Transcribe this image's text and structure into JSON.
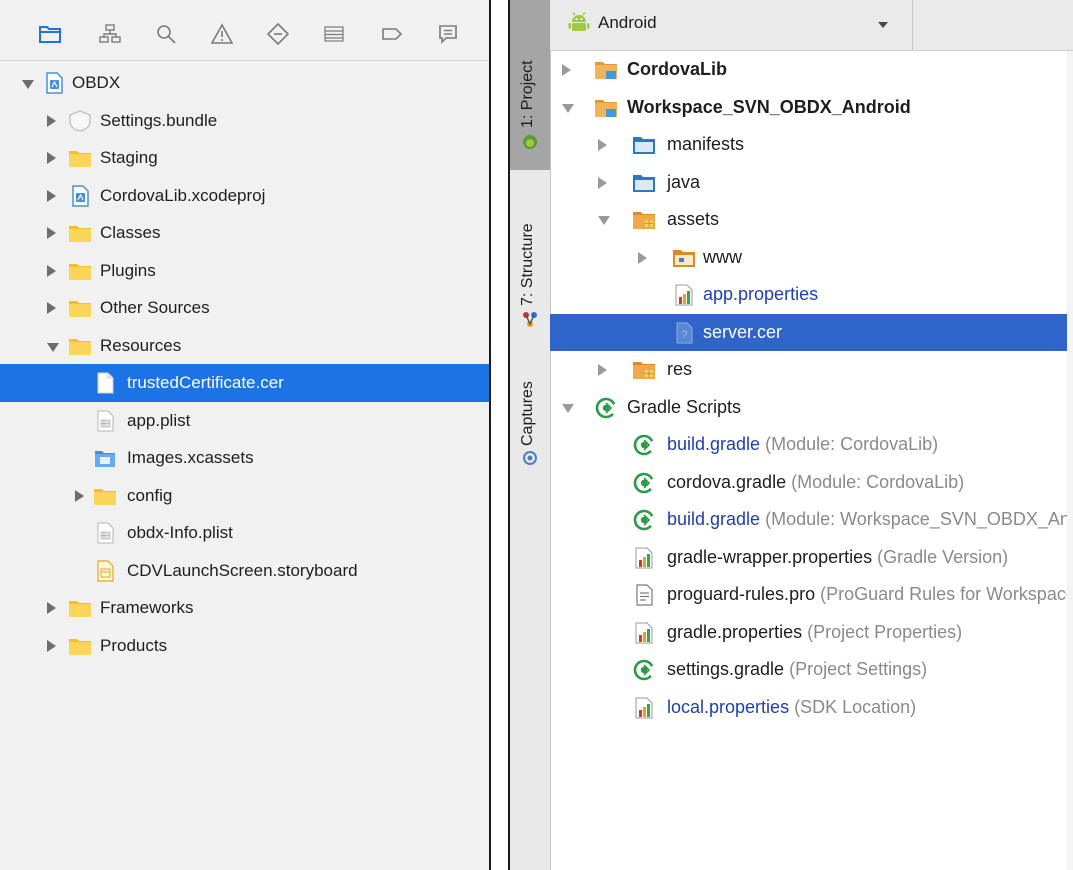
{
  "xcode": {
    "toolbar_icons": [
      "folder-icon",
      "hierarchy-icon",
      "search-icon",
      "warning-icon",
      "test-diamond-icon",
      "debug-list-icon",
      "breakpoint-tag-icon",
      "report-bubble-icon"
    ],
    "tree": [
      {
        "label": "OBDX",
        "depth": 0,
        "disclosure": "open",
        "icon": "xcodeproj-icon"
      },
      {
        "label": "Settings.bundle",
        "depth": 1,
        "disclosure": "closed",
        "icon": "bundle-icon"
      },
      {
        "label": "Staging",
        "depth": 1,
        "disclosure": "closed",
        "icon": "folder-icon"
      },
      {
        "label": "CordovaLib.xcodeproj",
        "depth": 1,
        "disclosure": "closed",
        "icon": "xcodeproj-icon"
      },
      {
        "label": "Classes",
        "depth": 1,
        "disclosure": "closed",
        "icon": "folder-icon"
      },
      {
        "label": "Plugins",
        "depth": 1,
        "disclosure": "closed",
        "icon": "folder-icon"
      },
      {
        "label": "Other Sources",
        "depth": 1,
        "disclosure": "closed",
        "icon": "folder-icon"
      },
      {
        "label": "Resources",
        "depth": 1,
        "disclosure": "open",
        "icon": "folder-icon"
      },
      {
        "label": "trustedCertificate.cer",
        "depth": 2,
        "disclosure": "none",
        "icon": "file-icon",
        "selected": true
      },
      {
        "label": "app.plist",
        "depth": 2,
        "disclosure": "none",
        "icon": "plist-icon"
      },
      {
        "label": "Images.xcassets",
        "depth": 2,
        "disclosure": "none",
        "icon": "xcassets-icon"
      },
      {
        "label": "config",
        "depth": 2,
        "disclosure": "closed",
        "icon": "folder-icon"
      },
      {
        "label": "obdx-Info.plist",
        "depth": 2,
        "disclosure": "none",
        "icon": "plist-icon"
      },
      {
        "label": "CDVLaunchScreen.storyboard",
        "depth": 2,
        "disclosure": "none",
        "icon": "storyboard-icon"
      },
      {
        "label": "Frameworks",
        "depth": 1,
        "disclosure": "closed",
        "icon": "folder-icon"
      },
      {
        "label": "Products",
        "depth": 1,
        "disclosure": "closed",
        "icon": "folder-icon"
      }
    ]
  },
  "studio": {
    "side_tabs": {
      "project": "1: Project",
      "structure": "7: Structure",
      "captures": "Captures"
    },
    "view_selector": "Android",
    "tree": [
      {
        "label": "CordovaLib",
        "note": "",
        "depth": 0,
        "disclosure": "closed",
        "icon": "module-folder-icon",
        "style": "bold"
      },
      {
        "label": "Workspace_SVN_OBDX_Android",
        "note": "",
        "depth": 0,
        "disclosure": "open",
        "icon": "module-folder-icon",
        "style": "bold"
      },
      {
        "label": "manifests",
        "note": "",
        "depth": 1,
        "disclosure": "closed",
        "icon": "blue-folder-icon",
        "style": "normal"
      },
      {
        "label": "java",
        "note": "",
        "depth": 1,
        "disclosure": "closed",
        "icon": "blue-folder-icon",
        "style": "normal"
      },
      {
        "label": "assets",
        "note": "",
        "depth": 1,
        "disclosure": "open",
        "icon": "resource-folder-icon",
        "style": "normal"
      },
      {
        "label": "www",
        "note": "",
        "depth": 2,
        "disclosure": "closed",
        "icon": "web-folder-icon",
        "style": "normal"
      },
      {
        "label": "app.properties",
        "note": "",
        "depth": 2,
        "disclosure": "none",
        "icon": "properties-icon",
        "style": "blue"
      },
      {
        "label": "server.cer",
        "note": "",
        "depth": 2,
        "disclosure": "none",
        "icon": "unknown-file-icon",
        "style": "normal",
        "selected": true
      },
      {
        "label": "res",
        "note": "",
        "depth": 1,
        "disclosure": "closed",
        "icon": "resource-folder-icon",
        "style": "normal"
      },
      {
        "label": "Gradle Scripts",
        "note": "",
        "depth": 0,
        "disclosure": "open",
        "icon": "gradle-icon",
        "style": "normal"
      },
      {
        "label": "build.gradle",
        "note": " (Module: CordovaLib)",
        "depth": 1,
        "disclosure": "none",
        "icon": "gradle-icon",
        "style": "blue"
      },
      {
        "label": "cordova.gradle",
        "note": " (Module: CordovaLib)",
        "depth": 1,
        "disclosure": "none",
        "icon": "gradle-icon",
        "style": "normal"
      },
      {
        "label": "build.gradle",
        "note": " (Module: Workspace_SVN_OBDX_Android)",
        "depth": 1,
        "disclosure": "none",
        "icon": "gradle-icon",
        "style": "blue"
      },
      {
        "label": "gradle-wrapper.properties",
        "note": " (Gradle Version)",
        "depth": 1,
        "disclosure": "none",
        "icon": "properties-icon",
        "style": "normal"
      },
      {
        "label": "proguard-rules.pro",
        "note": " (ProGuard Rules for Workspace_SVN_OBDX_Android)",
        "depth": 1,
        "disclosure": "none",
        "icon": "text-file-icon",
        "style": "normal"
      },
      {
        "label": "gradle.properties",
        "note": " (Project Properties)",
        "depth": 1,
        "disclosure": "none",
        "icon": "properties-icon",
        "style": "normal"
      },
      {
        "label": "settings.gradle",
        "note": " (Project Settings)",
        "depth": 1,
        "disclosure": "none",
        "icon": "gradle-icon",
        "style": "normal"
      },
      {
        "label": "local.properties",
        "note": " (SDK Location)",
        "depth": 1,
        "disclosure": "none",
        "icon": "properties-icon",
        "style": "blue"
      }
    ]
  },
  "colors": {
    "xcode_selection": "#1b73e6",
    "studio_selection": "#2f65ca",
    "folder_yellow": "#f6c743",
    "gradle_green": "#2d9a45",
    "link_blue": "#1f3fb5"
  }
}
